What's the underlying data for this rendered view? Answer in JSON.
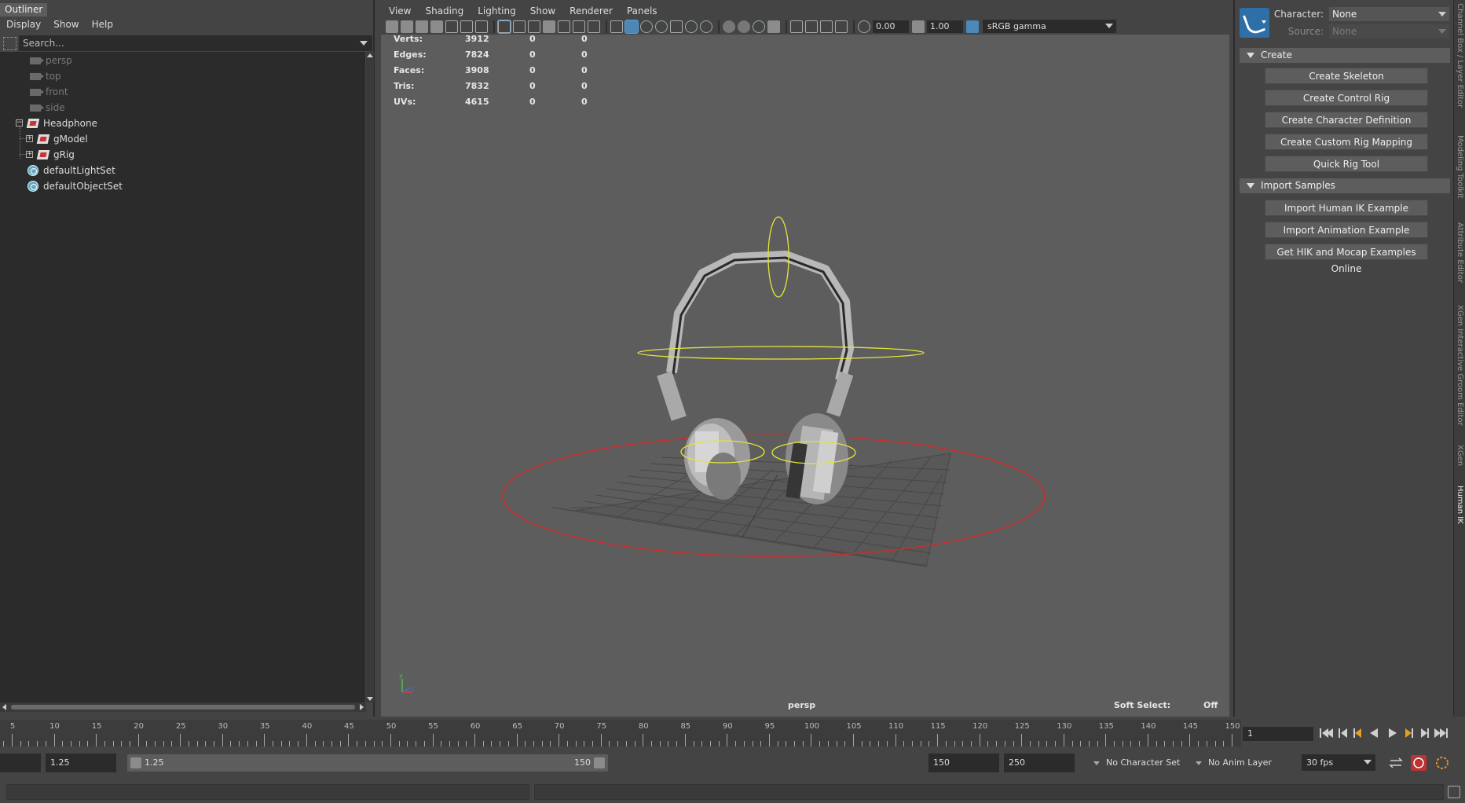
{
  "outliner": {
    "title": "Outliner",
    "menu": [
      "Display",
      "Show",
      "Help"
    ],
    "search_placeholder": "Search...",
    "items": [
      {
        "label": "persp",
        "type": "camera",
        "dim": true
      },
      {
        "label": "top",
        "type": "camera",
        "dim": true
      },
      {
        "label": "front",
        "type": "camera",
        "dim": true
      },
      {
        "label": "side",
        "type": "camera",
        "dim": true
      },
      {
        "label": "Headphone",
        "type": "group",
        "dim": false
      },
      {
        "label": "gModel",
        "type": "group",
        "dim": false
      },
      {
        "label": "gRig",
        "type": "group",
        "dim": false
      },
      {
        "label": "defaultLightSet",
        "type": "set",
        "dim": false
      },
      {
        "label": "defaultObjectSet",
        "type": "set",
        "dim": false
      }
    ]
  },
  "viewport": {
    "menu": [
      "View",
      "Shading",
      "Lighting",
      "Show",
      "Renderer",
      "Panels"
    ],
    "exposure": "0.00",
    "gamma": "1.00",
    "color_space": "sRGB gamma",
    "camera_label": "persp",
    "soft_select_label": "Soft Select:",
    "soft_select_value": "Off",
    "hud": [
      {
        "label": "Verts:",
        "v1": "3912",
        "v2": "0",
        "v3": "0"
      },
      {
        "label": "Edges:",
        "v1": "7824",
        "v2": "0",
        "v3": "0"
      },
      {
        "label": "Faces:",
        "v1": "3908",
        "v2": "0",
        "v3": "0"
      },
      {
        "label": "Tris:",
        "v1": "7832",
        "v2": "0",
        "v3": "0"
      },
      {
        "label": "UVs:",
        "v1": "4615",
        "v2": "0",
        "v3": "0"
      }
    ],
    "colors": {
      "ring": "#d02a2a",
      "controls": "#e4e43a"
    }
  },
  "hik": {
    "character_label": "Character:",
    "character_value": "None",
    "source_label": "Source:",
    "source_value": "None",
    "create_section": "Create",
    "create_buttons": [
      "Create Skeleton",
      "Create Control Rig",
      "Create Character Definition",
      "Create Custom Rig Mapping",
      "Quick Rig Tool"
    ],
    "import_section": "Import Samples",
    "import_buttons": [
      "Import Human IK Example",
      "Import Animation Example",
      "Get HIK and Mocap Examples Online"
    ]
  },
  "side_tabs": [
    "Channel Box / Layer Editor",
    "Modeling Toolkit",
    "Attribute Editor",
    "XGen Interactive Groom Editor",
    "XGen",
    "Human IK"
  ],
  "timeline": {
    "ticks": [
      "5",
      "10",
      "15",
      "20",
      "25",
      "30",
      "35",
      "40",
      "45",
      "50",
      "55",
      "60",
      "65",
      "70",
      "75",
      "80",
      "85",
      "90",
      "95",
      "100",
      "105",
      "110",
      "115",
      "120",
      "125",
      "130",
      "135",
      "140",
      "145",
      "150"
    ],
    "current_frame": "1"
  },
  "range": {
    "start_left": "",
    "start": "1.25",
    "slider_start": "1.25",
    "slider_end": "150",
    "end": "150",
    "end_total": "250",
    "character_set": "No Character Set",
    "anim_layer": "No Anim Layer",
    "fps": "30 fps"
  }
}
